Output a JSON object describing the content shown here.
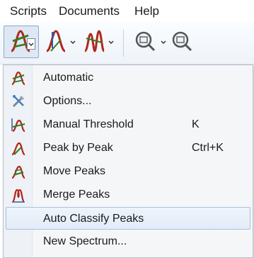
{
  "menubar": {
    "items": [
      {
        "label": "Scripts"
      },
      {
        "label": "Documents"
      },
      {
        "label": "Help"
      }
    ]
  },
  "toolbar": {
    "buttons": [
      {
        "icon": "auto-peak-icon",
        "has_dropdown": true,
        "pressed": true
      },
      {
        "icon": "peak-manual-icon",
        "has_dropdown": true
      },
      {
        "icon": "peak-multi-icon",
        "has_dropdown": true
      },
      {
        "icon": "zoom-icon",
        "has_dropdown": true
      },
      {
        "icon": "zoom-icon-2",
        "has_dropdown": false
      }
    ]
  },
  "menu": {
    "items": [
      {
        "label": "Automatic",
        "shortcut": "",
        "icon": "automatic-peak-icon"
      },
      {
        "label": "Options...",
        "shortcut": "",
        "icon": "tools-icon"
      },
      {
        "label": "Manual Threshold",
        "shortcut": "K",
        "icon": "manual-threshold-icon"
      },
      {
        "label": "Peak by Peak",
        "shortcut": "Ctrl+K",
        "icon": "peak-by-peak-icon"
      },
      {
        "label": "Move Peaks",
        "shortcut": "",
        "icon": "move-peaks-icon"
      },
      {
        "label": "Merge Peaks",
        "shortcut": "",
        "icon": "merge-peaks-icon"
      },
      {
        "label": "Auto Classify Peaks",
        "shortcut": "",
        "icon": "",
        "highlighted": true
      },
      {
        "label": "New Spectrum...",
        "shortcut": "",
        "icon": ""
      }
    ]
  },
  "colors": {
    "icon_green": "#2f7d1e",
    "icon_red": "#b3261e",
    "icon_blue": "#2b5fa6",
    "highlight_border": "#a9c0dc"
  }
}
